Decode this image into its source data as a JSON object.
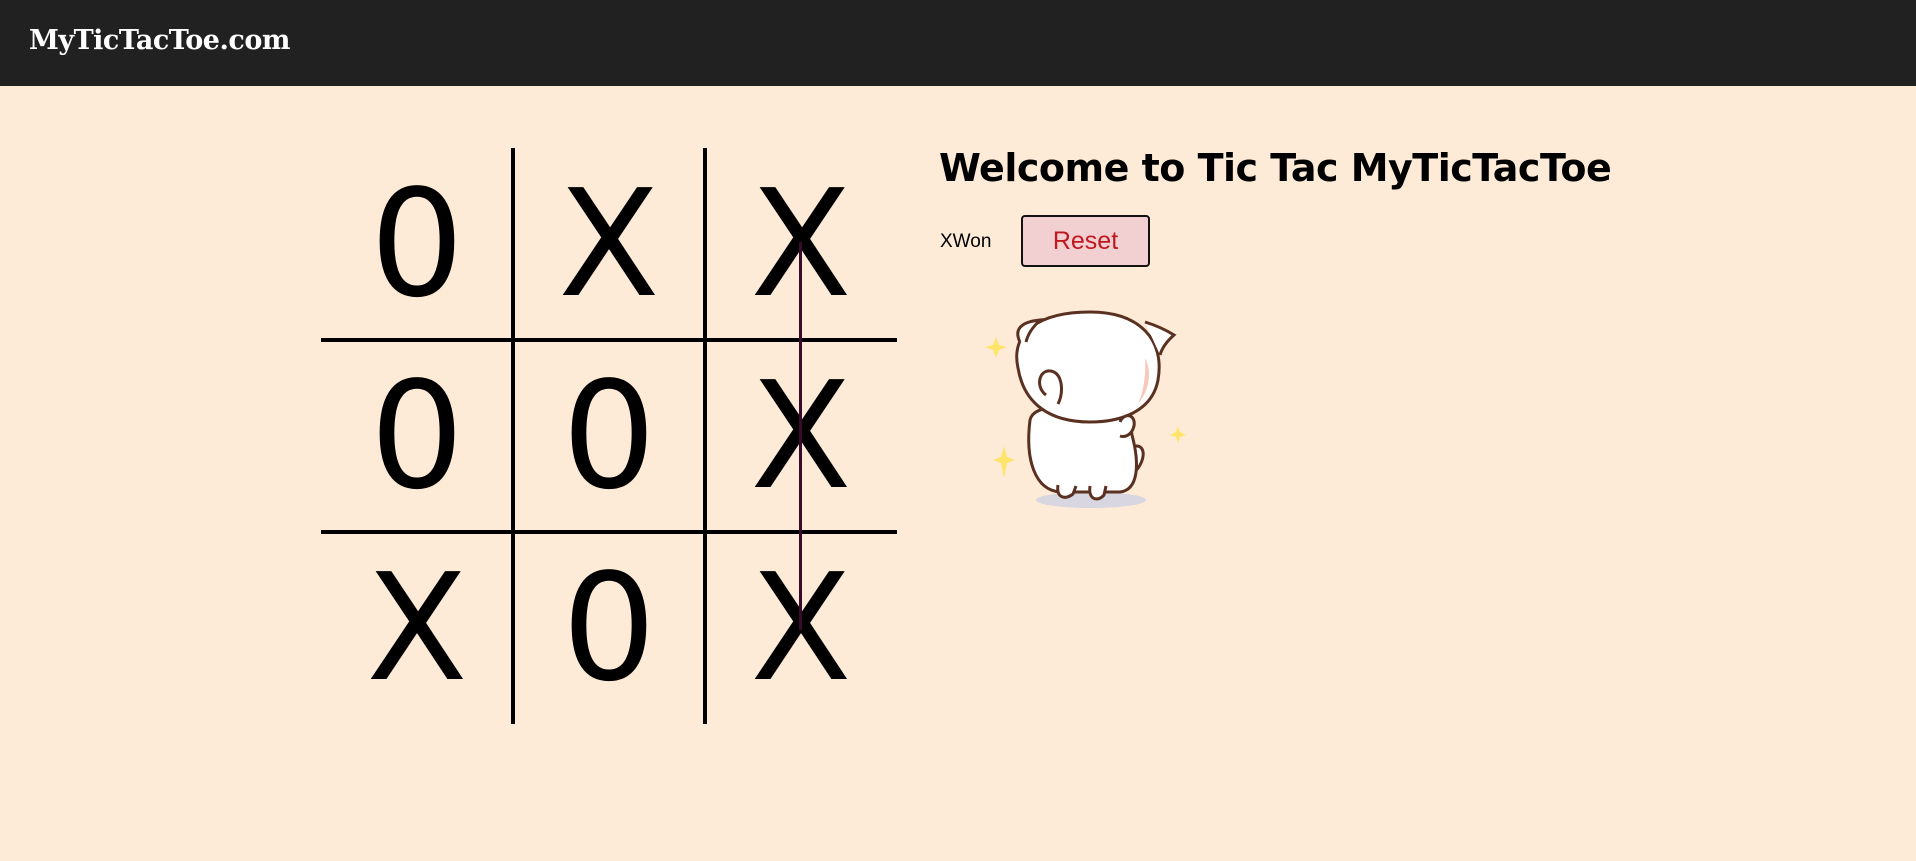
{
  "header": {
    "brand": "MyTicTacToe.com"
  },
  "board": {
    "cells": [
      "0",
      "X",
      "X",
      "0",
      "0",
      "X",
      "X",
      "0",
      "X"
    ],
    "winning_line": "right-column"
  },
  "panel": {
    "title": "Welcome to Tic Tac MyTicTacToe",
    "status": "XWon",
    "reset_label": "Reset"
  },
  "colors": {
    "background": "#fdebd8",
    "navbar": "#212121",
    "reset_bg": "#f2cfd0",
    "reset_text": "#c0181e",
    "win_line": "#3a0a2a"
  },
  "icons": {
    "mascot": "cat-celebrating-icon"
  }
}
